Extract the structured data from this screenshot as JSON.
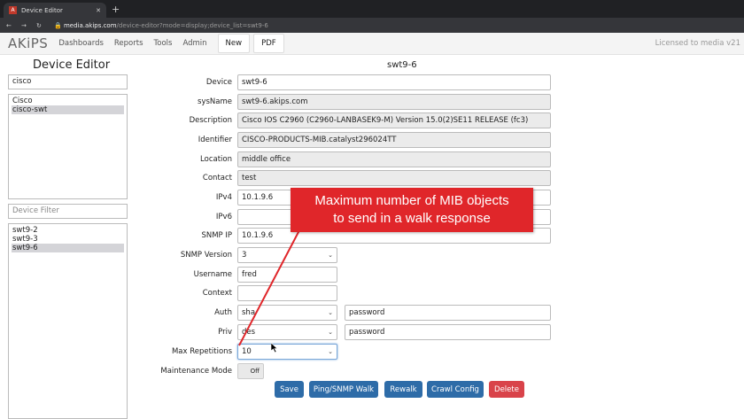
{
  "browser": {
    "tab_title": "Device Editor",
    "url_domain": "media.akips.com",
    "url_path": "/device-editor?mode=display;device_list=swt9-6"
  },
  "nav": {
    "logo": "AKiPS",
    "items": [
      "Dashboards",
      "Reports",
      "Tools",
      "Admin"
    ],
    "new_label": "New",
    "pdf_label": "PDF",
    "license": "Licensed to media  v21"
  },
  "sidebar": {
    "title": "Device Editor",
    "group_filter": "cisco",
    "groups": [
      {
        "label": "Cisco",
        "selected": false
      },
      {
        "label": "cisco-swt",
        "selected": true
      }
    ],
    "device_filter_placeholder": "Device Filter",
    "devices": [
      {
        "label": "swt9-2",
        "selected": false
      },
      {
        "label": "swt9-3",
        "selected": false
      },
      {
        "label": "swt9-6",
        "selected": true
      }
    ]
  },
  "form": {
    "title": "swt9-6",
    "fields": [
      {
        "label": "Device",
        "value": "swt9-6",
        "readonly": false
      },
      {
        "label": "sysName",
        "value": "swt9-6.akips.com",
        "readonly": true
      },
      {
        "label": "Description",
        "value": "Cisco IOS C2960 (C2960-LANBASEK9-M) Version 15.0(2)SE11 RELEASE (fc3)",
        "readonly": true
      },
      {
        "label": "Identifier",
        "value": "CISCO-PRODUCTS-MIB.catalyst296024TT",
        "readonly": true
      },
      {
        "label": "Location",
        "value": "middle office",
        "readonly": true
      },
      {
        "label": "Contact",
        "value": "test",
        "readonly": true
      },
      {
        "label": "IPv4",
        "value": "10.1.9.6",
        "readonly": false
      },
      {
        "label": "IPv6",
        "value": "",
        "readonly": false
      },
      {
        "label": "SNMP IP",
        "value": "10.1.9.6",
        "readonly": false
      }
    ],
    "snmp_version": {
      "label": "SNMP Version",
      "value": "3"
    },
    "username": {
      "label": "Username",
      "value": "fred"
    },
    "context": {
      "label": "Context",
      "value": ""
    },
    "auth": {
      "label": "Auth",
      "value": "sha",
      "password": "password"
    },
    "priv": {
      "label": "Priv",
      "value": "des",
      "password": "password"
    },
    "max_repetitions": {
      "label": "Max Repetitions",
      "value": "10"
    },
    "maintenance": {
      "label": "Maintenance Mode",
      "value": "Off"
    },
    "buttons": {
      "save": "Save",
      "ping": "Ping/SNMP Walk",
      "rewalk": "Rewalk",
      "crawl": "Crawl Config",
      "delete": "Delete"
    }
  },
  "callout": {
    "line1": "Maximum number of MIB objects",
    "line2": "to send in a walk response",
    "color": "#e0262a"
  },
  "colors": {
    "primary_button": "#2e6ca8",
    "danger_button": "#d9434a"
  }
}
